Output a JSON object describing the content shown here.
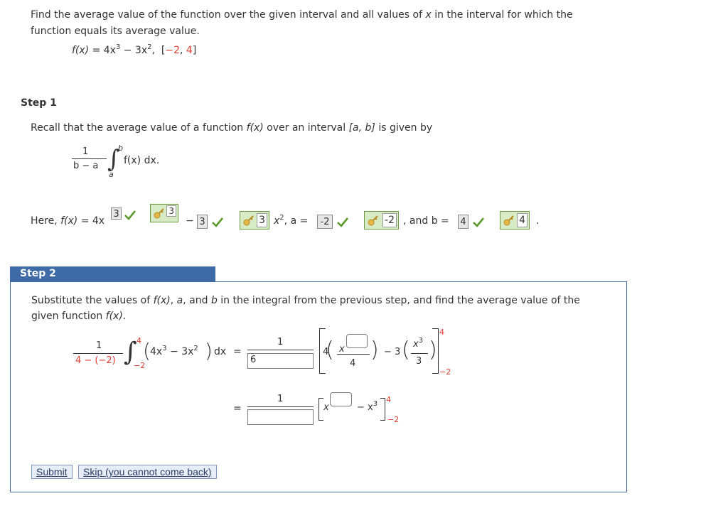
{
  "problem": {
    "instruction_line1": "Find the average value of the function over the given interval and all values of ",
    "x_var": "x",
    "instruction_line1_end": " in the interval for which the",
    "instruction_line2": "function equals its average value.",
    "function_lhs": "f(x)",
    "function_rhs_a": " = 4x",
    "exp3": "3",
    "function_rhs_b": " − 3x",
    "exp2": "2",
    "comma": ",",
    "interval_open": "[",
    "interval_a": "−2",
    "interval_sep": ", ",
    "interval_b": "4",
    "interval_close": "]"
  },
  "step1": {
    "label": "Step 1",
    "recall_a": "Recall that the average value of a function ",
    "recall_fx": "f(x)",
    "recall_b": " over an interval ",
    "recall_interval": "[a, b]",
    "recall_c": " is given by",
    "formula_num": "1",
    "formula_den": "b − a",
    "integral_upper": "b",
    "integral_lower": "a",
    "integrand": "f(x) dx.",
    "here_a": "Here, ",
    "here_fx": "f(x)",
    "here_eq": " = 4x",
    "ans_exp": "3",
    "key_exp": "3",
    "minus": "−",
    "ans_coef": "3",
    "key_coef": "3",
    "x2": "x",
    "x2_exp": "2",
    "a_eq": ", a = ",
    "ans_a": "-2",
    "key_a": "-2",
    "and_b": ", and b = ",
    "ans_b": "4",
    "key_b": "4",
    "period": "."
  },
  "step2": {
    "label": "Step 2",
    "sub_a": "Substitute the values of ",
    "sub_fx": "f(x)",
    "sub_b": ", ",
    "sub_a_var": "a",
    "sub_c": ", and ",
    "sub_b_var": "b",
    "sub_d": " in the integral from the previous step, and find the average value of the",
    "sub_line2_a": "given function ",
    "sub_line2_fx": "f(x)",
    "sub_line2_end": ".",
    "lhs_num": "1",
    "lhs_den": "4 − (−2)",
    "lhs_upper": "4",
    "lhs_lower": "−2",
    "lhs_integrand": "4x",
    "lhs_exp3": "3",
    "lhs_minus": " − 3x",
    "lhs_exp2": "2",
    "lhs_dx": "dx",
    "eq": "=",
    "rhs1_num": "1",
    "rhs1_den_value": "6",
    "rhs1_coef4": "4",
    "rhs1_x": "x",
    "rhs1_den4": "4",
    "rhs1_minus3": "− 3",
    "rhs1_x3": "x",
    "rhs1_x3_exp": "3",
    "rhs1_den3": "3",
    "rhs1_upper": "4",
    "rhs1_lower": "−2",
    "rhs2_num": "1",
    "rhs2_den_value": "",
    "rhs2_x": "x",
    "rhs2_minus": "− x",
    "rhs2_exp": "3",
    "rhs2_upper": "4",
    "rhs2_lower": "−2"
  },
  "buttons": {
    "submit": "Submit",
    "skip": "Skip (you cannot come back)"
  },
  "colors": {
    "accent_blue": "#3f6aa8",
    "red": "#e03a2e",
    "check_green": "#5a9a2a"
  }
}
